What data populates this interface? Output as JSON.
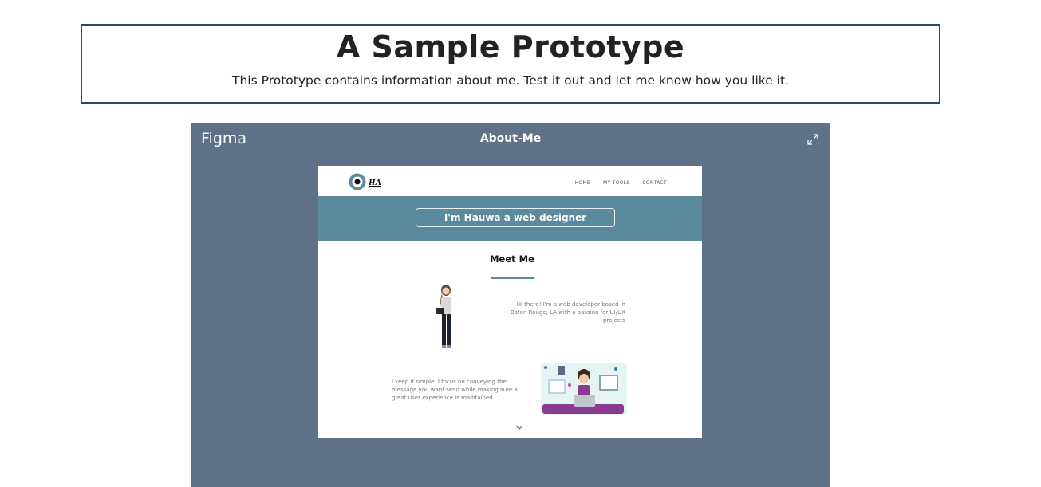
{
  "header": {
    "title": "A Sample Prototype",
    "subtitle": "This Prototype contains information about me. Test it out and let me know how you like it."
  },
  "embed": {
    "brand": "Figma",
    "frame_name": "About-Me",
    "expand_icon": "expand-icon"
  },
  "prototype": {
    "logo_text": "HA",
    "nav": [
      "HOME",
      "MY TOOLS",
      "CONTACT"
    ],
    "hero_button": "I'm Hauwa a web designer",
    "section_title": "Meet Me",
    "paragraph_1": "Hi there! I'm a web developer based in Baton Rouge, LA with a passion for UI/UX projects",
    "paragraph_2": "I keep it simple. I focus on conveying the message you want send while making  sure a great user experience is maintained",
    "scroll_icon": "chevron-down-icon"
  },
  "colors": {
    "embed_bg": "#5f7189",
    "hero_bg": "#5b8a9e",
    "header_border": "#2f4a5e"
  }
}
